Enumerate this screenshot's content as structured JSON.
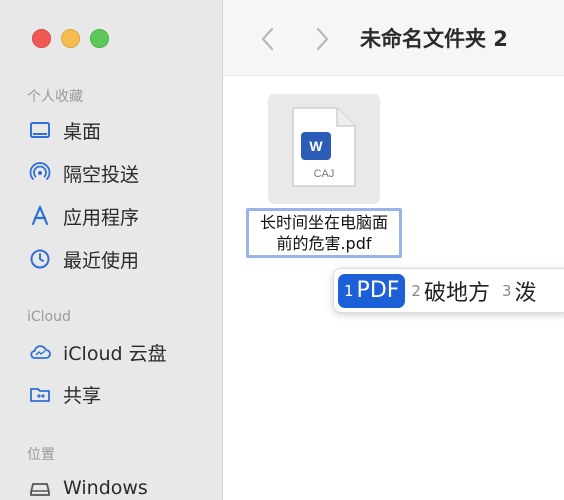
{
  "window": {
    "title": "未命名文件夹 2"
  },
  "sidebar": {
    "sections": [
      {
        "title": "个人收藏",
        "items": [
          {
            "label": "桌面",
            "icon": "desktop-icon"
          },
          {
            "label": "隔空投送",
            "icon": "airdrop-icon"
          },
          {
            "label": "应用程序",
            "icon": "applications-icon"
          },
          {
            "label": "最近使用",
            "icon": "clock-icon"
          }
        ]
      },
      {
        "title": "iCloud",
        "items": [
          {
            "label": "iCloud 云盘",
            "icon": "cloud-icon"
          },
          {
            "label": "共享",
            "icon": "shared-folder-icon"
          }
        ]
      },
      {
        "title": "位置",
        "items": [
          {
            "label": "Windows",
            "icon": "drive-icon"
          }
        ]
      }
    ]
  },
  "file": {
    "icon_ext": "CAJ",
    "icon_badge": "W",
    "name_line1": "长时间坐在电脑面",
    "name_line2": "前的危害.pdf"
  },
  "ime": {
    "candidates": [
      {
        "num": "1",
        "text": "PDF",
        "selected": true
      },
      {
        "num": "2",
        "text": "破地方",
        "selected": false
      },
      {
        "num": "3",
        "text": "泼",
        "selected": false
      }
    ]
  },
  "colors": {
    "accent": "#1d5fd6",
    "sidebar_icon": "#2f6fd6"
  }
}
